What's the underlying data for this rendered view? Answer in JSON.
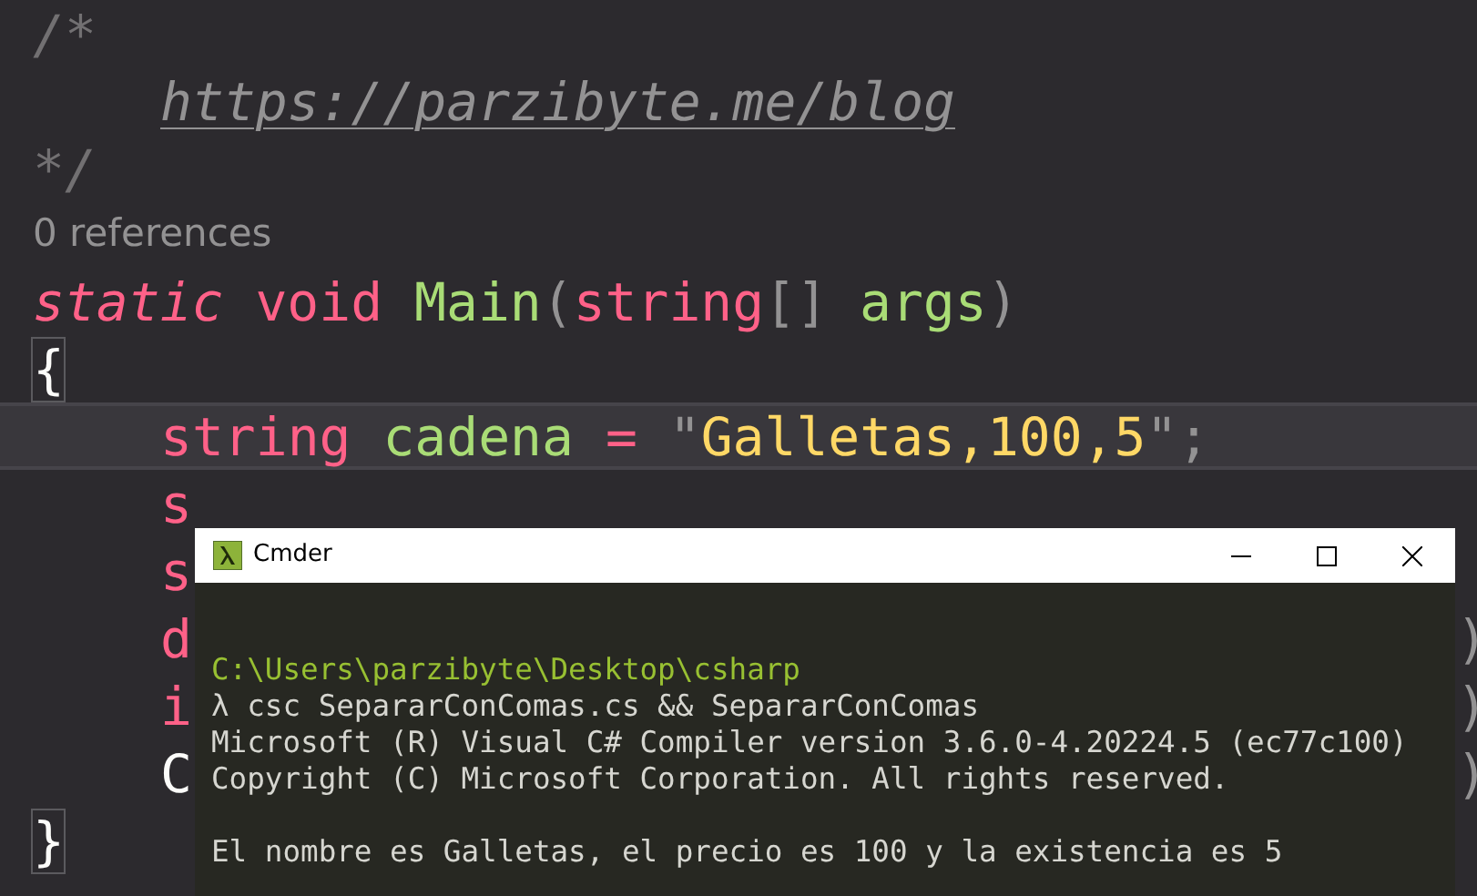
{
  "editor": {
    "lines": [
      {
        "tokens": [
          {
            "text": "/*",
            "kind": "comment"
          }
        ]
      },
      {
        "indented": true,
        "tokens": [
          {
            "text": "https://parzibyte.me/blog",
            "kind": "link"
          }
        ]
      },
      {
        "tokens": [
          {
            "text": "*/",
            "kind": "comment"
          }
        ]
      },
      {
        "codelens": "0 references"
      },
      {
        "tokens": [
          {
            "text": "static ",
            "kind": "modifier"
          },
          {
            "text": "void ",
            "kind": "keyword"
          },
          {
            "text": "Main",
            "kind": "name"
          },
          {
            "text": "(",
            "kind": "punct"
          },
          {
            "text": "string",
            "kind": "keyword"
          },
          {
            "text": "[] ",
            "kind": "punct"
          },
          {
            "text": "args",
            "kind": "name"
          },
          {
            "text": ")",
            "kind": "punct"
          }
        ]
      },
      {
        "tokens": [
          {
            "text": "{",
            "kind": "bracket_match"
          }
        ]
      },
      {
        "current": true,
        "indented": true,
        "tokens": [
          {
            "text": "string ",
            "kind": "keyword"
          },
          {
            "text": "cadena ",
            "kind": "name"
          },
          {
            "text": "= ",
            "kind": "keyword"
          },
          {
            "text": "\"",
            "kind": "punct"
          },
          {
            "text": "Galletas,100,5",
            "kind": "string"
          },
          {
            "text": "\"",
            "kind": "punct"
          },
          {
            "text": ";",
            "kind": "punct"
          }
        ]
      },
      {
        "indented": true,
        "tokens": [
          {
            "text": "s",
            "kind": "keyword"
          }
        ]
      },
      {
        "indented": true,
        "tokens": [
          {
            "text": "s",
            "kind": "keyword"
          }
        ]
      },
      {
        "indented": true,
        "tokens": [
          {
            "text": "d",
            "kind": "keyword"
          }
        ],
        "tail": ")"
      },
      {
        "indented": true,
        "tokens": [
          {
            "text": "i",
            "kind": "keyword"
          }
        ],
        "tail": ")"
      },
      {
        "indented": true,
        "tokens": [
          {
            "text": "C",
            "kind": "plain"
          }
        ],
        "tail": ")"
      },
      {
        "tokens": [
          {
            "text": "}",
            "kind": "bracket_match"
          }
        ]
      }
    ]
  },
  "terminal": {
    "title": "Cmder",
    "lines": [
      {
        "kind": "blank"
      },
      {
        "kind": "path",
        "text": "C:\\Users\\parzibyte\\Desktop\\csharp"
      },
      {
        "kind": "output",
        "text": "λ csc SepararConComas.cs && SepararConComas"
      },
      {
        "kind": "output",
        "text": "Microsoft (R) Visual C# Compiler version 3.6.0-4.20224.5 (ec77c100)"
      },
      {
        "kind": "output",
        "text": "Copyright (C) Microsoft Corporation. All rights reserved."
      },
      {
        "kind": "blank"
      },
      {
        "kind": "output",
        "text": "El nombre es Galletas, el precio es 100 y la existencia es 5"
      }
    ]
  }
}
